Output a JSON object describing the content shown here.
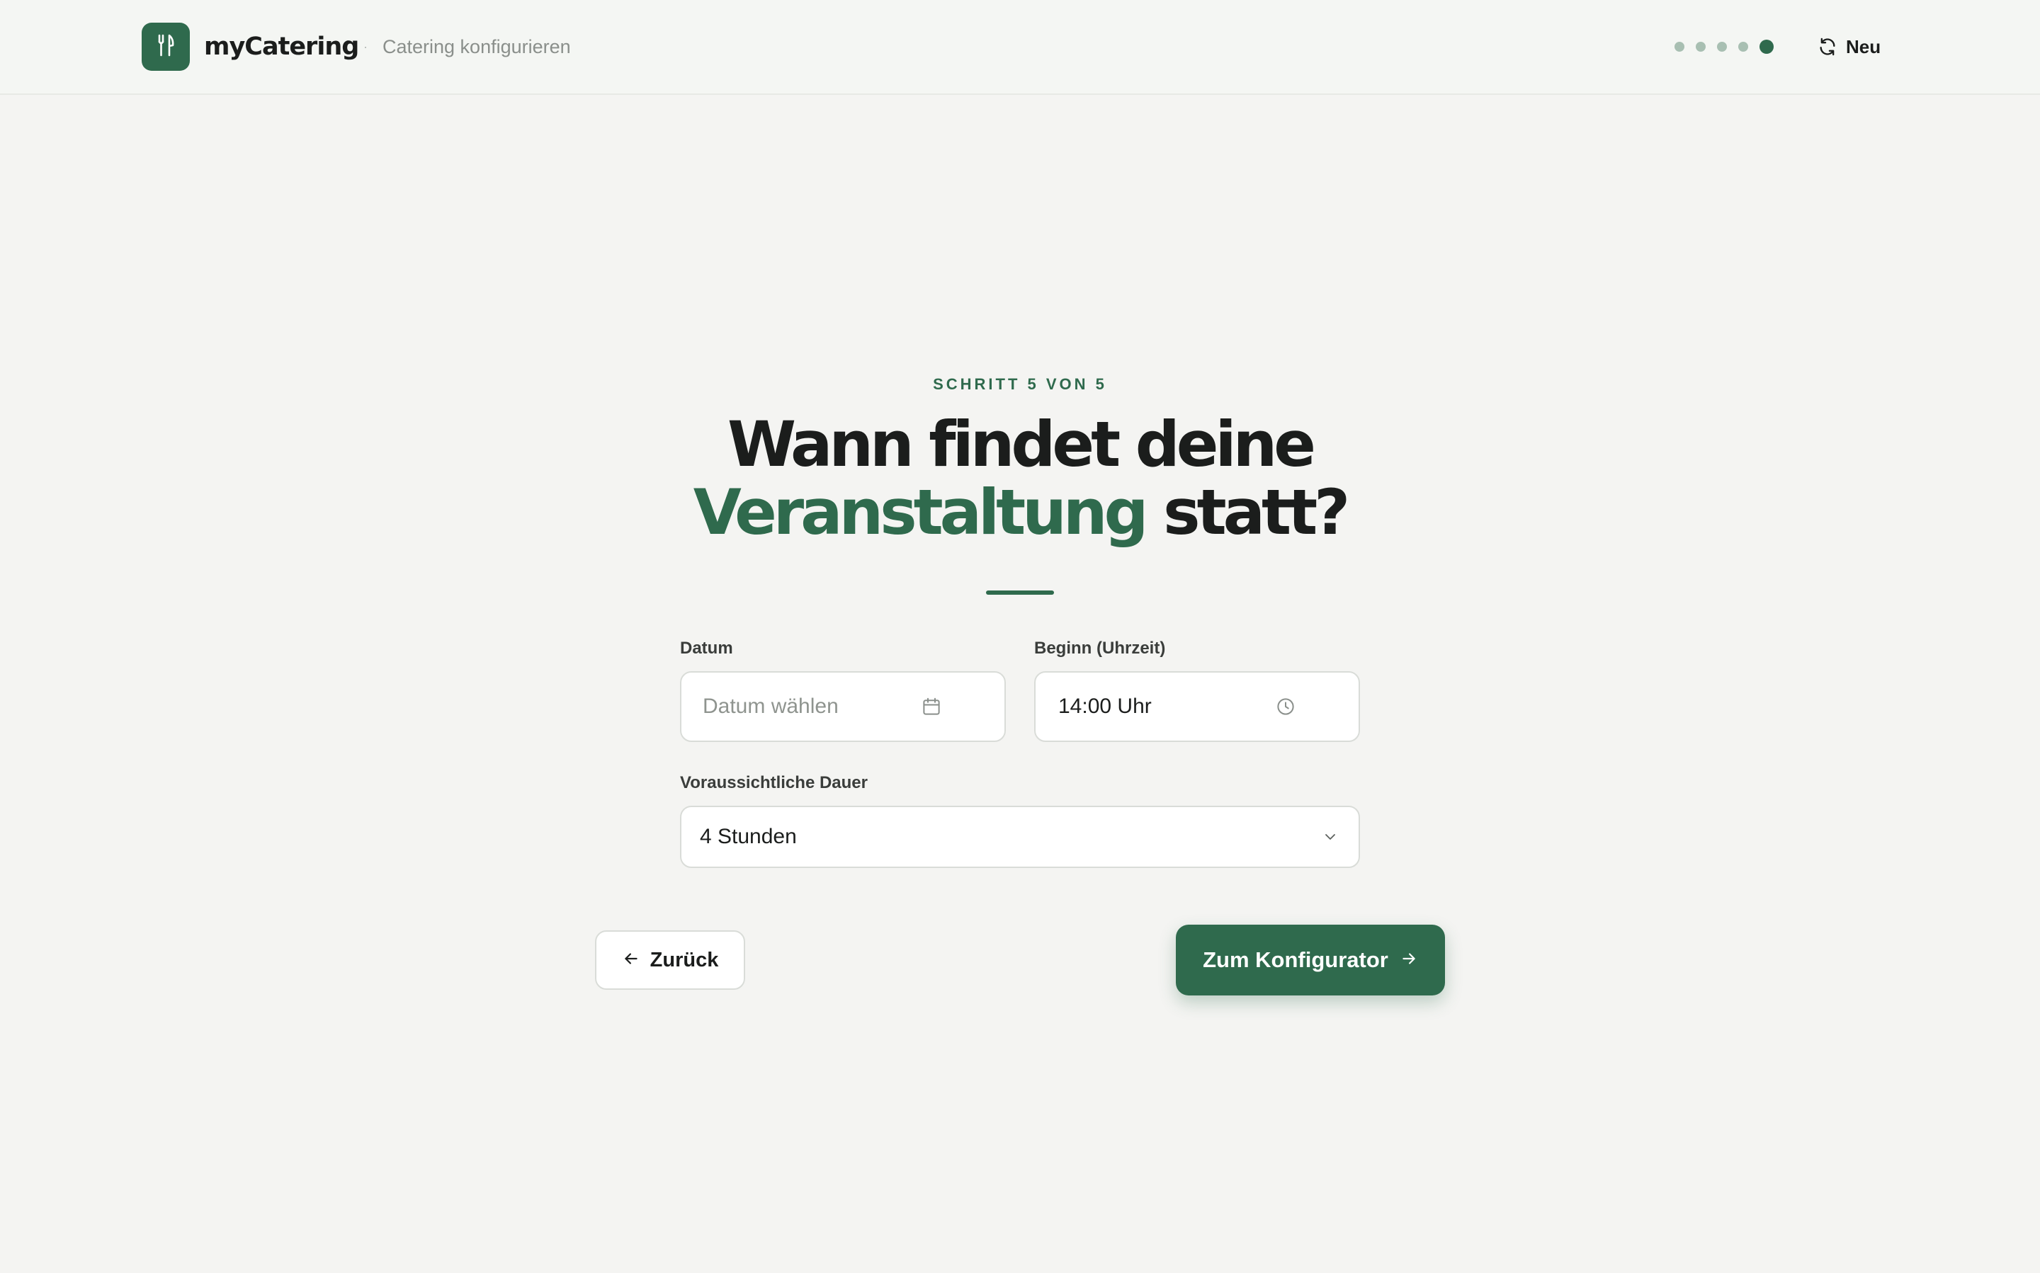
{
  "header": {
    "brand": "myCatering",
    "separator": "·",
    "subtitle": "Catering konfigurieren",
    "progress": {
      "total_steps": 5,
      "current_step": 5
    },
    "new_label": "Neu"
  },
  "step": {
    "label": "SCHRITT 5 VON 5",
    "headline_line1": "Wann findet deine",
    "headline_accent": "Veranstaltung",
    "headline_rest": " statt?"
  },
  "form": {
    "date": {
      "label": "Datum",
      "placeholder": "Datum wählen",
      "value": ""
    },
    "time": {
      "label": "Beginn (Uhrzeit)",
      "value": "14:00 Uhr"
    },
    "duration": {
      "label": "Voraussichtliche Dauer",
      "selected": "4 Stunden"
    }
  },
  "actions": {
    "back_label": "Zurück",
    "next_label": "Zum Konfigurator"
  },
  "colors": {
    "accent": "#2f6a4d",
    "background": "#f4f4f2",
    "text": "#1b1d1c"
  },
  "icons": {
    "logo": "fork-knife-icon",
    "new": "refresh-icon",
    "date": "calendar-icon",
    "time": "clock-icon",
    "duration": "chevron-down-icon",
    "back": "arrow-left-icon",
    "next": "arrow-right-icon"
  }
}
